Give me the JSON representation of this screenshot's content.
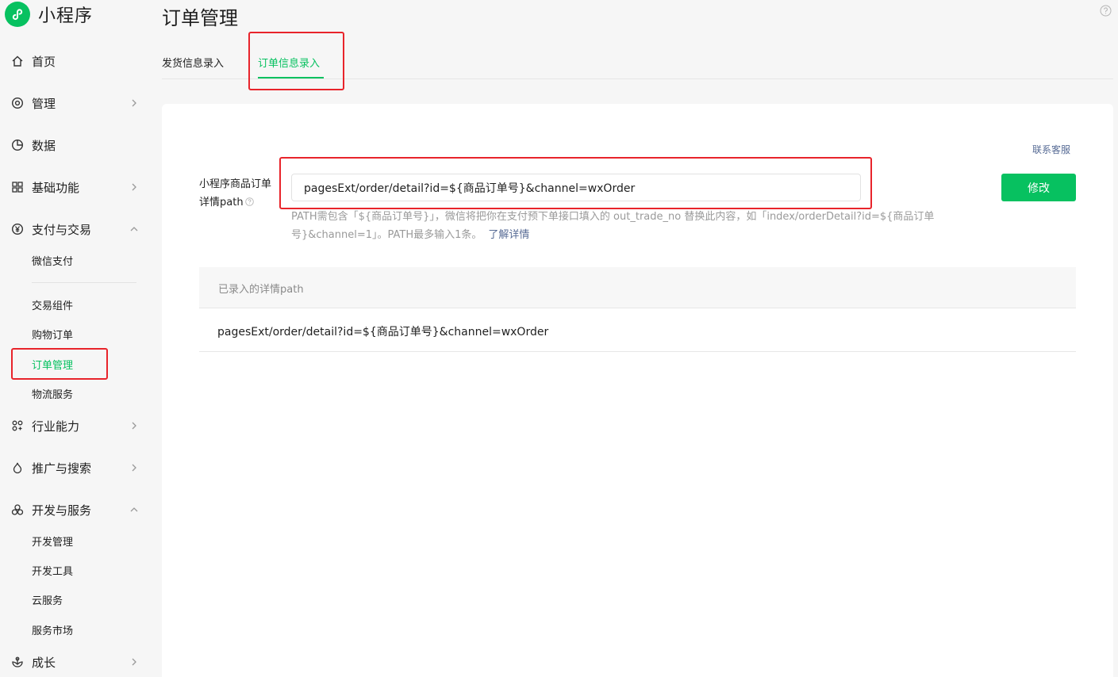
{
  "app": {
    "logo_text": "小程序"
  },
  "sidebar": {
    "items": [
      {
        "label": "首页",
        "icon": "home-icon"
      },
      {
        "label": "管理",
        "icon": "manage-icon",
        "chevron": "right"
      },
      {
        "label": "数据",
        "icon": "data-pie-icon"
      },
      {
        "label": "基础功能",
        "icon": "grid-icon",
        "chevron": "right"
      },
      {
        "label": "支付与交易",
        "icon": "yuan-icon",
        "chevron": "up"
      },
      {
        "label": "行业能力",
        "icon": "industry-icon",
        "chevron": "right"
      },
      {
        "label": "推广与搜索",
        "icon": "promote-icon",
        "chevron": "right"
      },
      {
        "label": "开发与服务",
        "icon": "dev-icon",
        "chevron": "up"
      },
      {
        "label": "成长",
        "icon": "growth-icon",
        "chevron": "right"
      }
    ],
    "payment_sub": [
      "微信支付",
      "交易组件",
      "购物订单",
      "订单管理",
      "物流服务"
    ],
    "dev_sub": [
      "开发管理",
      "开发工具",
      "云服务",
      "服务市场"
    ],
    "active_sub": "订单管理"
  },
  "header": {
    "title": "订单管理",
    "tabs": [
      {
        "label": "发货信息录入",
        "active": false
      },
      {
        "label": "订单信息录入",
        "active": true
      }
    ]
  },
  "form": {
    "contact_label": "联系客服",
    "field_label_line1": "小程序商品订单",
    "field_label_line2": "详情path",
    "path_value": "pagesExt/order/detail?id=${商品订单号}&channel=wxOrder",
    "modify_label": "修改",
    "hint_line1": "PATH需包含「${商品订单号}」，微信将把你在支付预下单接口填入的 out_trade_no 替换此内容，如「index/orderDetail?id=${商品订单",
    "hint_line2": "号}&channel=1」。PATH最多输入1条。",
    "hint_link": "了解详情"
  },
  "table": {
    "header": "已录入的详情path",
    "rows": [
      "pagesExt/order/detail?id=${商品订单号}&channel=wxOrder"
    ]
  },
  "colors": {
    "brand_green": "#07c160",
    "link_blue": "#576b95",
    "highlight_red": "#e8242b"
  }
}
